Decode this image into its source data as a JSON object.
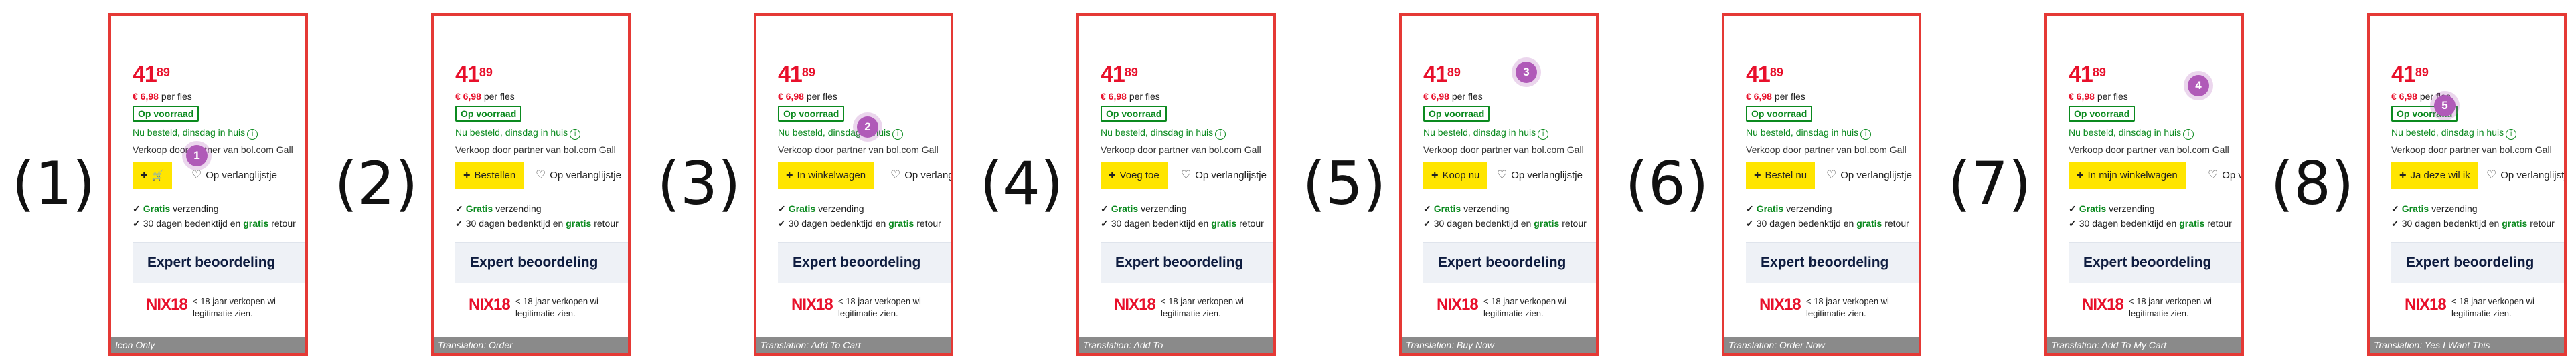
{
  "labels": [
    "(1)",
    "(2)",
    "(3)",
    "(4)",
    "(5)",
    "(6)",
    "(7)",
    "(8)"
  ],
  "product": {
    "price_int": "41",
    "price_dec": "89",
    "per_bottle_price": "€ 6,98",
    "per_bottle_suffix": "per fles",
    "stock_badge": "Op voorraad",
    "delivery": "Nu besteld, dinsdag in huis",
    "seller": "Verkoop door partner van bol.com Gall",
    "wishlist": "Op verlanglijstje",
    "shipping_free": "Gratis",
    "shipping_rest": "verzending",
    "returns_pre": "30 dagen bedenktijd en",
    "returns_free": "gratis",
    "returns_post": "retour",
    "expert_title": "Expert beoordeling",
    "nix_logo": "NIX18",
    "nix_line1": "< 18 jaar verkopen wi",
    "nix_line2": "legitimatie zien."
  },
  "variants": [
    {
      "button": "",
      "caption": "Icon Only",
      "marker": "1"
    },
    {
      "button": "Bestellen",
      "caption": "Translation: Order",
      "marker": ""
    },
    {
      "button": "In winkelwagen",
      "caption": "Translation: Add To Cart",
      "marker": "2"
    },
    {
      "button": "Voeg toe",
      "caption": "Translation: Add To",
      "marker": ""
    },
    {
      "button": "Koop nu",
      "caption": "Translation: Buy Now",
      "marker": "3"
    },
    {
      "button": "Bestel nu",
      "caption": "Translation: Order Now",
      "marker": ""
    },
    {
      "button": "In mijn winkelwagen",
      "caption": "Translation: Add To My Cart",
      "marker": "4"
    },
    {
      "button": "Ja deze wil ik",
      "caption": "Translation: Yes I Want This",
      "marker": "5"
    }
  ],
  "colors": {
    "frame": "#e53935",
    "price": "#e8102b",
    "button": "#ffe500",
    "stock": "#0b8a1f",
    "marker": "#b05ab8"
  }
}
